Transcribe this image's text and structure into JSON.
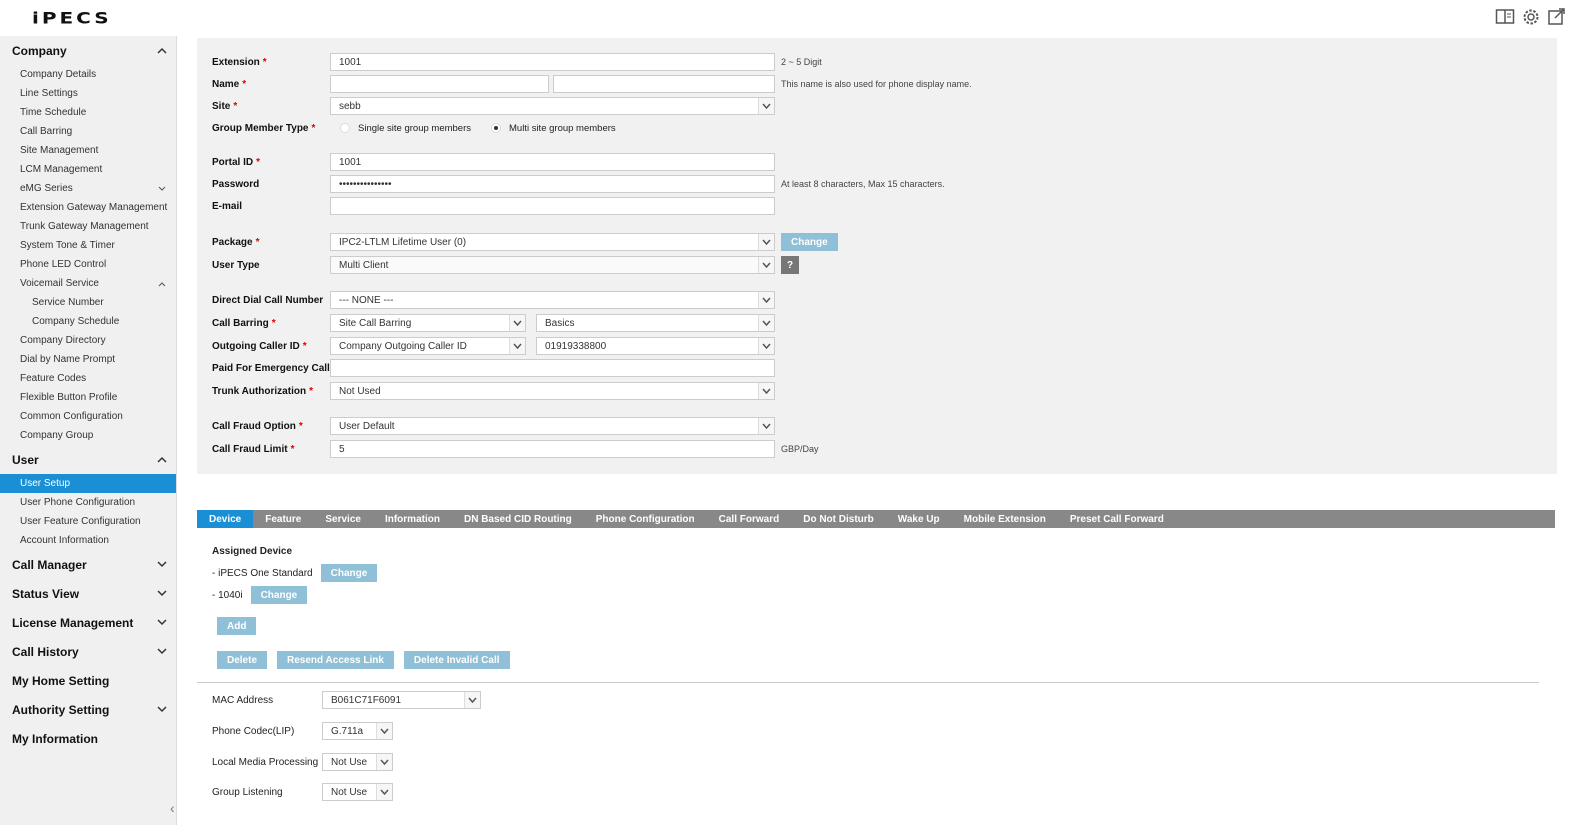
{
  "header": {
    "logo": "iPECS",
    "icons": [
      "book-icon",
      "gear-icon",
      "export-icon"
    ]
  },
  "sidebar": {
    "company": {
      "title": "Company",
      "items": [
        "Company Details",
        "Line Settings",
        "Time Schedule",
        "Call Barring",
        "Site Management",
        "LCM Management",
        "eMG Series",
        "Extension Gateway Management",
        "Trunk Gateway Management",
        "System Tone & Timer",
        "Phone LED Control",
        "Voicemail Service"
      ],
      "voicemail_sub": [
        "Service Number",
        "Company Schedule"
      ],
      "items2": [
        "Company Directory",
        "Dial by Name Prompt",
        "Feature Codes",
        "Flexible Button Profile",
        "Common Configuration",
        "Company Group"
      ]
    },
    "user": {
      "title": "User",
      "items": [
        "User Setup",
        "User Phone Configuration",
        "User Feature Configuration",
        "Account Information"
      ]
    },
    "sections": [
      "Call Manager",
      "Status View",
      "License Management",
      "Call History",
      "My Home Setting",
      "Authority Setting",
      "My Information"
    ]
  },
  "form": {
    "extension": {
      "label": "Extension",
      "value": "1001",
      "hint": "2 ~ 5 Digit"
    },
    "name": {
      "label": "Name",
      "first": "",
      "last": "",
      "hint": "This name is also used for phone display name."
    },
    "site": {
      "label": "Site",
      "value": "sebb"
    },
    "group_member_type": {
      "label": "Group Member Type",
      "opt1": "Single site group members",
      "opt2": "Multi site group members"
    },
    "portal_id": {
      "label": "Portal ID",
      "value": "1001"
    },
    "password": {
      "label": "Password",
      "value": "•••••••••••••••",
      "hint": "At least 8 characters, Max 15 characters."
    },
    "email": {
      "label": "E-mail",
      "value": ""
    },
    "package": {
      "label": "Package",
      "value": "IPC2-LTLM Lifetime User (0)",
      "button": "Change"
    },
    "user_type": {
      "label": "User Type",
      "value": "Multi Client",
      "help": "?"
    },
    "direct_dial": {
      "label": "Direct Dial Call Number",
      "value": "--- NONE ---"
    },
    "call_barring": {
      "label": "Call Barring",
      "value1": "Site Call Barring",
      "value2": "Basics"
    },
    "outgoing_cid": {
      "label": "Outgoing Caller ID",
      "value1": "Company Outgoing Caller ID",
      "value2": "01919338800"
    },
    "paid_emergency": {
      "label": "Paid For Emergency Call",
      "value": ""
    },
    "trunk_auth": {
      "label": "Trunk Authorization",
      "value": "Not Used"
    },
    "fraud_option": {
      "label": "Call Fraud Option",
      "value": "User Default"
    },
    "fraud_limit": {
      "label": "Call Fraud Limit",
      "value": "5",
      "hint": "GBP/Day"
    },
    "required_mark": "*"
  },
  "tabs": [
    "Device",
    "Feature",
    "Service",
    "Information",
    "DN Based CID Routing",
    "Phone Configuration",
    "Call Forward",
    "Do Not Disturb",
    "Wake Up",
    "Mobile Extension",
    "Preset Call Forward"
  ],
  "device": {
    "assigned_title": "Assigned Device",
    "dev1": "- iPECS One Standard",
    "dev2": "- 1040i",
    "change": "Change",
    "add": "Add",
    "delete": "Delete",
    "resend": "Resend Access Link",
    "delete_invalid": "Delete Invalid Call",
    "mac": {
      "label": "MAC Address",
      "value": "B061C71F6091"
    },
    "codec": {
      "label": "Phone Codec(LIP)",
      "value": "G.711a"
    },
    "lmp": {
      "label": "Local Media Processing",
      "value": "Not Use"
    },
    "group_listening": {
      "label": "Group Listening",
      "value": "Not Use"
    }
  }
}
